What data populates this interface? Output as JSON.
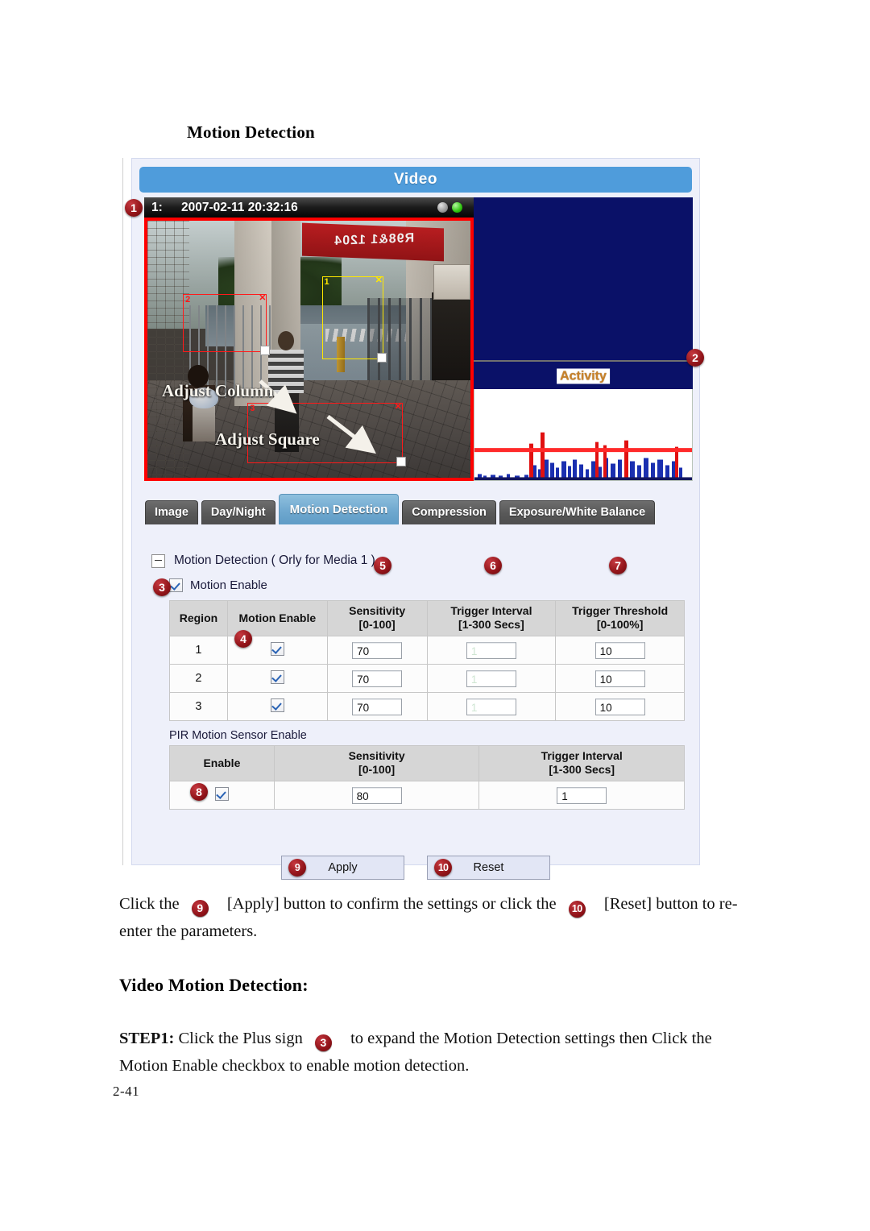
{
  "document": {
    "heading_motion_detection": "Motion Detection",
    "heading_video_motion_detection": "Video Motion Detection:",
    "page_number": "2-41",
    "paragraph_apply_reset": {
      "part1": "Click the",
      "badge_apply": "9",
      "part2": "[Apply] button to confirm the settings or click the",
      "badge_reset": "10",
      "part3": "[Reset] button to re-enter the parameters."
    },
    "paragraph_step1": {
      "label": "STEP1:",
      "part1": "Click the Plus sign",
      "badge_plus": "3",
      "part2": "to expand the Motion Detection settings then Click the Motion Enable checkbox to enable motion detection."
    }
  },
  "ui": {
    "window_title": "Video",
    "camera": {
      "channel_label": "1:",
      "timestamp": "2007-02-11 20:32:16",
      "led_gray": "status-led-gray",
      "led_green": "status-led-green",
      "banner_text": "R98&1 1204",
      "annotations": [
        {
          "text": "Adjust Column"
        },
        {
          "text": "Adjust Square"
        }
      ],
      "regions": [
        {
          "label": "1",
          "color": "#ffe800",
          "close": "✕"
        },
        {
          "label": "2",
          "color": "#ff1a1a",
          "close": "✕"
        },
        {
          "label": "3",
          "color": "#ff1a1a",
          "close": "✕"
        }
      ]
    },
    "activity": {
      "label": "Activity",
      "label_color": "#c8822a",
      "panel_color": "#0a1168",
      "threshold_line_color": "#ff2a2a",
      "bar_color": "#1a2fb0",
      "spike_color": "#e01010"
    },
    "tabs": [
      {
        "label": "Image",
        "active": false
      },
      {
        "label": "Day/Night",
        "active": false
      },
      {
        "label": "Motion Detection",
        "active": true
      },
      {
        "label": "Compression",
        "active": false
      },
      {
        "label": "Exposure/White Balance",
        "active": false
      }
    ],
    "section": {
      "title": "Motion Detection ( Orly for Media 1 )",
      "collapse_icon": "minus-icon",
      "motion_enable_label": "Motion Enable",
      "motion_enable_checked": true
    },
    "region_table": {
      "headers": [
        {
          "line1": "Region",
          "line2": ""
        },
        {
          "line1": "Motion Enable",
          "line2": ""
        },
        {
          "line1": "Sensitivity",
          "line2": "[0-100]"
        },
        {
          "line1": "Trigger Interval",
          "line2": "[1-300 Secs]"
        },
        {
          "line1": "Trigger Threshold",
          "line2": "[0-100%]"
        }
      ],
      "rows": [
        {
          "region": "1",
          "enabled": true,
          "sensitivity": "70",
          "trigger_interval": "1",
          "trigger_threshold": "10"
        },
        {
          "region": "2",
          "enabled": true,
          "sensitivity": "70",
          "trigger_interval": "1",
          "trigger_threshold": "10"
        },
        {
          "region": "3",
          "enabled": true,
          "sensitivity": "70",
          "trigger_interval": "1",
          "trigger_threshold": "10"
        }
      ]
    },
    "pir": {
      "label": "PIR Motion Sensor Enable",
      "headers": [
        {
          "line1": "Enable",
          "line2": ""
        },
        {
          "line1": "Sensitivity",
          "line2": "[0-100]"
        },
        {
          "line1": "Trigger Interval",
          "line2": "[1-300 Secs]"
        }
      ],
      "row": {
        "enabled": true,
        "sensitivity": "80",
        "trigger_interval": "1"
      }
    },
    "buttons": {
      "apply": "Apply",
      "reset": "Reset"
    },
    "callouts": {
      "c1": "1",
      "c2": "2",
      "c3": "3",
      "c4": "4",
      "c5": "5",
      "c6": "6",
      "c7": "7",
      "c8": "8",
      "c9": "9",
      "c10": "10"
    }
  }
}
